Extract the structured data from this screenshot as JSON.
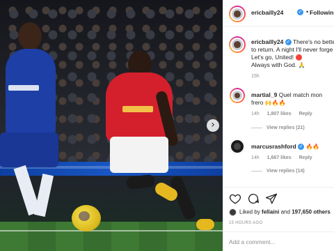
{
  "post": {
    "username": "ericbailly24",
    "follow_label": "Following",
    "dot": "•",
    "verified_mark": "✓"
  },
  "caption": {
    "username": "ericbailly24",
    "line1": "There's no better",
    "line2": "to return. A night I'll never forge",
    "line3": "Let's go, United!",
    "line4": "Always with God.",
    "time": "15h"
  },
  "comments": [
    {
      "username": "martial_9",
      "text": "Quel match mon",
      "text2": "frero",
      "emoji": "🙌🔥🔥",
      "time": "14h",
      "likes": "1,807 likes",
      "reply": "Reply",
      "view_replies": "View replies (21)"
    },
    {
      "username": "marcusrashford",
      "emoji": "🔥🔥",
      "time": "14h",
      "likes": "1,667 likes",
      "reply": "Reply",
      "view_replies": "View replies (14)"
    }
  ],
  "likes_line": {
    "prefix": "Liked by",
    "user": "fellaini",
    "middle": "and",
    "count": "197,650 others"
  },
  "timestamp": "15 HOURS AGO",
  "add_comment_placeholder": "Add a comment...",
  "icons": {
    "like": "heart-icon",
    "comment": "comment-icon",
    "share": "share-icon",
    "next": "chevron-right-icon"
  },
  "next_arrow": "›",
  "colors": {
    "verified": "#3897f0",
    "muted": "#8e8e8e",
    "text": "#262626"
  }
}
